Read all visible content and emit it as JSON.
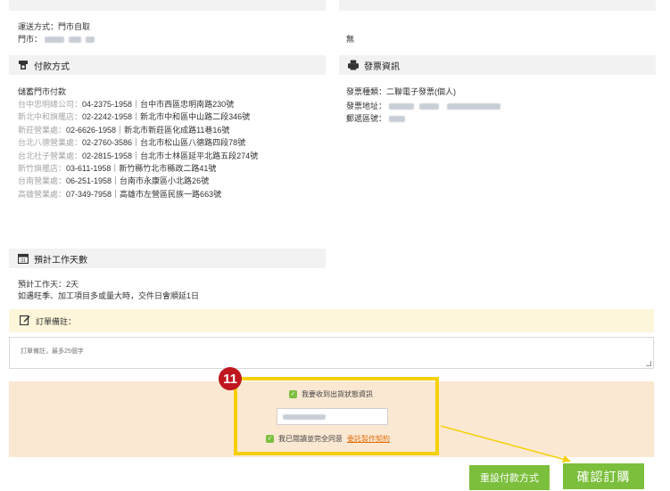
{
  "shipping": {
    "delivery_method": "運送方式：門市自取",
    "store_label": "門市："
  },
  "invoice_none": "無",
  "payment": {
    "title": "付款方式",
    "intro": "儲蓄門市付款",
    "stores": [
      {
        "name": "台中忠明總公司：",
        "detail": "04-2375-1958｜台中市西區忠明南路230號"
      },
      {
        "name": "新北中和旗艦店：",
        "detail": "02-2242-1958｜新北市中和區中山路二段346號"
      },
      {
        "name": "新莊營業處：",
        "detail": "02-6626-1958｜新北市新莊區化成路11巷16號"
      },
      {
        "name": "台北八德營業處：",
        "detail": "02-2760-3586｜台北市松山區八德路四段78號"
      },
      {
        "name": "台北社子營業處：",
        "detail": "02-2815-1958｜台北市士林區延平北路五段274號"
      },
      {
        "name": "新竹旗艦店：",
        "detail": "03-611-1958｜新竹縣竹北市縣政二路41號"
      },
      {
        "name": "台南營業處：",
        "detail": "06-251-1958｜台南市永康區小北路26號"
      },
      {
        "name": "高雄營業處：",
        "detail": "07-349-7958｜高雄市左營區民族一路663號"
      }
    ]
  },
  "invoice": {
    "title": "發票資訊",
    "type": "發票種類：二聯電子發票(個人)",
    "address_label": "發票地址：",
    "zip_label": "郵遞區號："
  },
  "workdays": {
    "title": "預計工作天數",
    "line1": "預計工作天：2天",
    "line2": "如遇旺季、加工項目多或量大時，交件日會順延1日"
  },
  "note": {
    "title": "訂單備註：",
    "placeholder": "訂單備註，最多25個字"
  },
  "consent": {
    "receive_shipping_info": "我要收到出貨狀態資訊",
    "agree_prefix": "我已閱讀並完全同意",
    "agree_link": "委託製作契約"
  },
  "step_badge": "11",
  "buttons": {
    "reset": "重設付款方式",
    "confirm": "確認訂購"
  },
  "colors": {
    "accent_green": "#7bbf3c",
    "highlight_yellow": "#f5d00a",
    "badge_red": "#c0161f",
    "link_orange": "#e06f0c"
  }
}
